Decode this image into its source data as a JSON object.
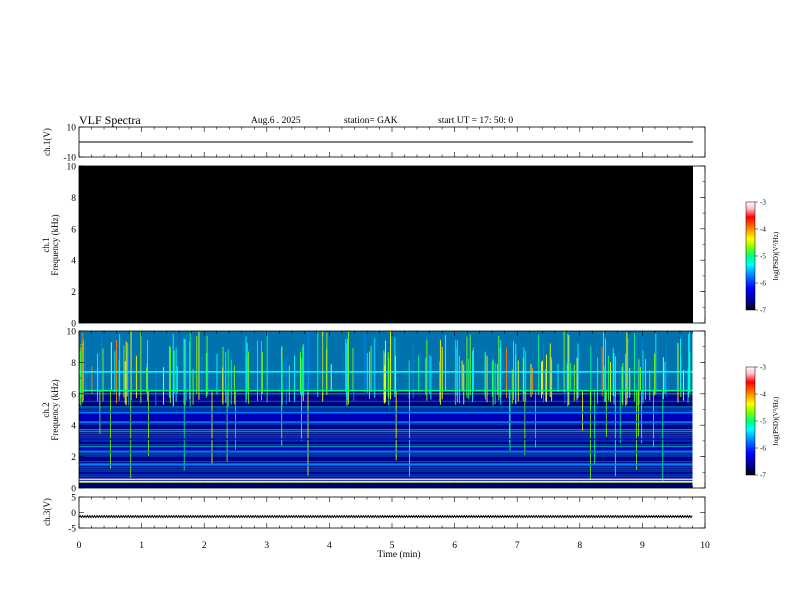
{
  "header": {
    "title": "VLF  Spectra",
    "date": "Aug.6   . 2025",
    "station": "station= GAK",
    "start_ut": "start  UT  =    17: 50: 0"
  },
  "chart_data": [
    {
      "name": "ch.1 waveform",
      "type": "line",
      "ylabel": "ch.1(V)",
      "ylim": [
        -10,
        10
      ],
      "y_ticks": [
        "10",
        "-10"
      ],
      "xlim": [
        0,
        10
      ],
      "trace_level": 0
    },
    {
      "name": "ch.1 spectrogram",
      "type": "heatmap",
      "ylabel": "ch.1\nFrequency  (kHz)",
      "ylim": [
        0,
        10
      ],
      "y_ticks": [
        "0",
        "2",
        "4",
        "6",
        "8",
        "10"
      ],
      "xlim": [
        0,
        9.8
      ],
      "state": "no signal (all below log PSD -7)",
      "colorbar": {
        "label": "log(PSD)(V²/Hz)",
        "range": [
          -7,
          -3
        ],
        "ticks": [
          "-3",
          "-4",
          "-5",
          "-6",
          "-7"
        ]
      }
    },
    {
      "name": "ch.2 spectrogram",
      "type": "heatmap",
      "ylabel": "ch.2\nFrequency  (kHz)",
      "ylim": [
        0,
        10
      ],
      "y_ticks": [
        "0",
        "2",
        "4",
        "6",
        "8",
        "10"
      ],
      "xlim": [
        0,
        9.8
      ],
      "bands_khz": [
        {
          "f": 0.4,
          "level": -4.5
        },
        {
          "f": 0.55,
          "level": -3.3
        },
        {
          "f": 1.5,
          "level": -6.0
        },
        {
          "f": 2.3,
          "level": -6.0
        },
        {
          "f": 3.1,
          "level": -6.1
        },
        {
          "f": 4.2,
          "level": -5.9
        },
        {
          "f": 4.8,
          "level": -5.8
        },
        {
          "f": 6.2,
          "level": -5.2
        },
        {
          "f": 7.4,
          "level": -5.6
        }
      ],
      "upper_band_khz": [
        6.2,
        10
      ],
      "upper_band_level": -5.5,
      "colorbar": {
        "label": "log(PSD)(V²/Hz)",
        "range": [
          -7,
          -3
        ],
        "ticks": [
          "-3",
          "-4",
          "-5",
          "-6",
          "-7"
        ]
      }
    },
    {
      "name": "ch.3 waveform",
      "type": "line",
      "ylabel": "ch.3(V)",
      "ylim": [
        -5,
        5
      ],
      "y_ticks": [
        "5",
        "0",
        "-5"
      ],
      "xlim": [
        0,
        10
      ],
      "trace_level": -1.3,
      "trace_amplitude": 0.3
    }
  ],
  "time_axis": {
    "xlabel": "Time  (min)",
    "ticks": [
      "0",
      "1",
      "2",
      "3",
      "4",
      "5",
      "6",
      "7",
      "8",
      "9",
      "10"
    ],
    "xlim": [
      0,
      10
    ]
  },
  "colors": {
    "colormap": [
      "#000000",
      "#00008b",
      "#0000ff",
      "#0080ff",
      "#00ffff",
      "#00ff80",
      "#80ff00",
      "#ffff00",
      "#ff8000",
      "#ff0000",
      "#ffc0d0",
      "#ffffff"
    ]
  }
}
